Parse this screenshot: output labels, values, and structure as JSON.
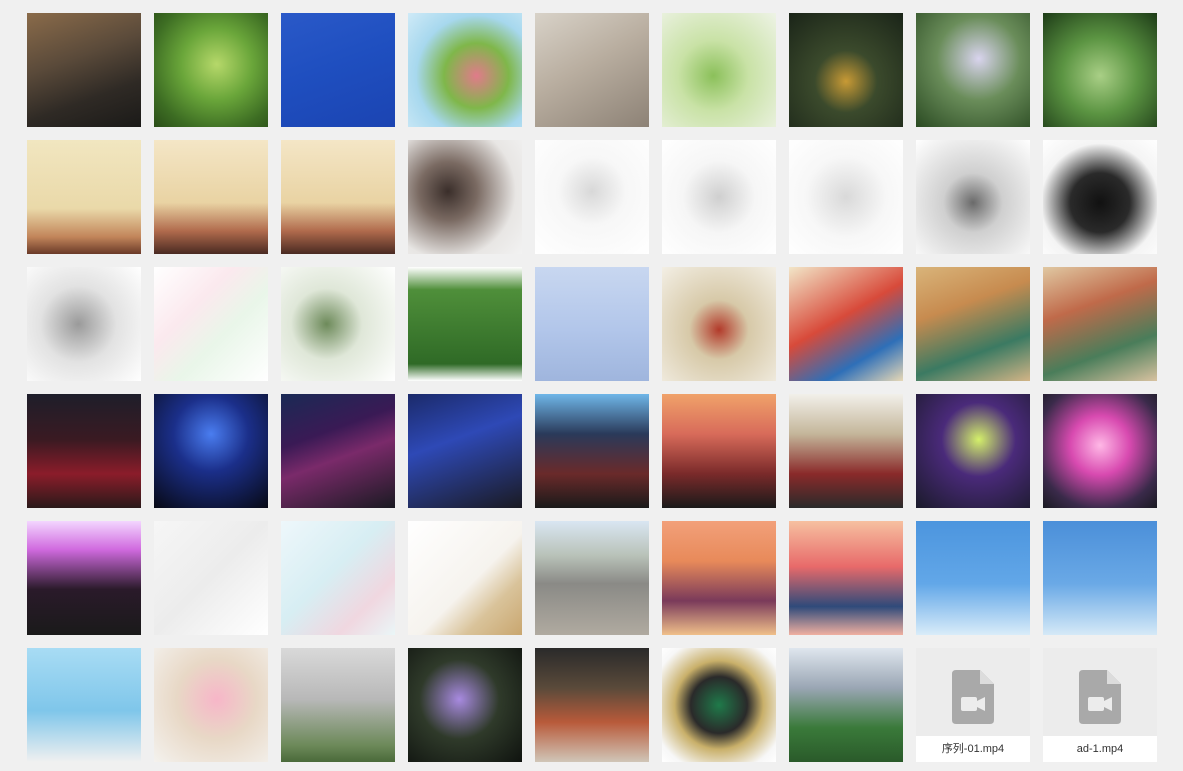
{
  "gallery": {
    "tiles": [
      {
        "kind": "image",
        "icon": "boardwalk-photo-icon",
        "bg": "linear-gradient(160deg,#8a6b4a 0%,#5a4a3a 40%,#2f2a25 70%,#1b1a18 100%)"
      },
      {
        "kind": "image",
        "icon": "green-plant-photo-icon",
        "bg": "radial-gradient(circle at 55% 45%,#b6d86a 0%,#6aa63a 40%,#3d6d23 75%,#2a4d18 100%)"
      },
      {
        "kind": "image",
        "icon": "blue-sky-contrail-photo-icon",
        "bg": "linear-gradient(160deg,#2a59c8 0%,#1f4fc0 45%,#1b44b2 100%)"
      },
      {
        "kind": "image",
        "icon": "peach-blossom-photo-icon",
        "bg": "radial-gradient(circle at 60% 55%,#e07b8a 0%,#7fb74a 35%,#a7d8ee 65%,#cfeaf7 100%)"
      },
      {
        "kind": "image",
        "icon": "cat-photo-icon",
        "bg": "linear-gradient(150deg,#d8d2c8 0%,#b9aea0 45%,#8d8276 100%)"
      },
      {
        "kind": "image",
        "icon": "green-bud-photo-icon",
        "bg": "radial-gradient(circle at 45% 55%,#8bc05a 0%,#c9e2a6 40%,#eef3e6 100%)"
      },
      {
        "kind": "image",
        "icon": "bird-photo-icon",
        "bg": "radial-gradient(circle at 50% 60%,#c89a35 0%,#3b4a2c 35%,#1a2418 100%)"
      },
      {
        "kind": "image",
        "icon": "lilac-flower-photo-icon",
        "bg": "radial-gradient(circle at 55% 40%,#d9d4ee 0%,#6a8d5a 45%,#2a4a22 100%)"
      },
      {
        "kind": "image",
        "icon": "lotus-leaf-photo-icon",
        "bg": "radial-gradient(circle at 50% 55%,#a9cf86 0%,#5b9442 45%,#1d3b17 100%)"
      },
      {
        "kind": "image",
        "icon": "poster-warrior-photo-icon",
        "bg": "linear-gradient(180deg,#f1e6c0 0%,#ead9a9 60%,#c2855a 85%,#6a3a28 100%)"
      },
      {
        "kind": "image",
        "icon": "poster-woman-photo-icon",
        "bg": "linear-gradient(180deg,#f4e6c6 0%,#e9d3a3 55%,#b06a4c 80%,#4a2a22 100%)"
      },
      {
        "kind": "image",
        "icon": "poster-woman-photo-icon",
        "bg": "linear-gradient(180deg,#f4e6c6 0%,#e9d3a3 55%,#b06a4c 80%,#4a2a22 100%)"
      },
      {
        "kind": "image",
        "icon": "portrait-photo-icon",
        "bg": "radial-gradient(circle at 35% 45%,#3a2e2a 0%,#7a6a62 30%,#e8e6e4 70%,#f2f2f2 100%)"
      },
      {
        "kind": "image",
        "icon": "illustration-girl-photo-icon",
        "bg": "radial-gradient(circle at 50% 45%,#d8d8d8 0%,#f7f7f7 40%,#ffffff 100%)"
      },
      {
        "kind": "image",
        "icon": "illustration-figures-photo-icon",
        "bg": "radial-gradient(circle at 50% 50%,#cfcfcf 0%,#f6f6f6 45%,#ffffff 100%)"
      },
      {
        "kind": "image",
        "icon": "sketch-figures-photo-icon",
        "bg": "radial-gradient(circle at 50% 50%,#d9d9d9 0%,#f7f7f7 50%,#ffffff 100%)"
      },
      {
        "kind": "image",
        "icon": "sketch-character-photo-icon",
        "bg": "radial-gradient(circle at 50% 55%,#6a6a6a 0%,#cfcfcf 35%,#ffffff 100%)"
      },
      {
        "kind": "image",
        "icon": "umbrella-figure-photo-icon",
        "bg": "radial-gradient(circle at 50% 55%,#111111 0%,#2a2a2a 35%,#f4f4f4 70%,#ffffff 100%)"
      },
      {
        "kind": "image",
        "icon": "sketch-scene-photo-icon",
        "bg": "radial-gradient(circle at 45% 50%,#9a9a9a 0%,#e2e2e2 45%,#ffffff 100%)"
      },
      {
        "kind": "image",
        "icon": "collage-portraits-photo-icon",
        "bg": "linear-gradient(135deg,#ffffff 0%,#fbe9ee 35%,#e9f6e9 60%,#ffffff 100%)"
      },
      {
        "kind": "image",
        "icon": "circle-collage-photo-icon",
        "bg": "radial-gradient(circle at 40% 50%,#6d8a5a 0%,#dfe7d8 40%,#ffffff 100%)"
      },
      {
        "kind": "image",
        "icon": "lawn-couple-photo-icon",
        "bg": "linear-gradient(180deg,#ffffff 0%,#4f8f3a 20%,#2f6a26 85%,#ffffff 100%)"
      },
      {
        "kind": "image",
        "icon": "studio-group-photo-icon",
        "bg": "linear-gradient(180deg,#c8d7f0 0%,#b2c6ea 55%,#9fb5dd 100%)"
      },
      {
        "kind": "image",
        "icon": "ink-painting-photo-icon",
        "bg": "radial-gradient(circle at 50% 55%,#b23a2a 0%,#d7c9a8 35%,#f3efe5 100%)"
      },
      {
        "kind": "image",
        "icon": "traditional-figures-photo-icon",
        "bg": "linear-gradient(150deg,#f2e6c8 0%,#d84a3a 45%,#2e6fb8 75%,#e7d8b6 100%)"
      },
      {
        "kind": "image",
        "icon": "palace-scene-photo-icon",
        "bg": "linear-gradient(160deg,#d9b47a 0%,#c78b4f 35%,#3b7a62 70%,#d2b486 100%)"
      },
      {
        "kind": "image",
        "icon": "courtyard-scene-photo-icon",
        "bg": "linear-gradient(160deg,#e0c8a2 0%,#c06a4a 35%,#4a7d5a 70%,#d8c2a0 100%)"
      },
      {
        "kind": "image",
        "icon": "choir-stage-photo-icon",
        "bg": "linear-gradient(180deg,#1e1e2a 0%,#3a1a22 40%,#8b1c2a 70%,#2a1a1a 100%)"
      },
      {
        "kind": "image",
        "icon": "moon-stage-photo-icon",
        "bg": "radial-gradient(circle at 50% 35%,#4a7df0 0%,#1b2f8a 40%,#070914 100%)"
      },
      {
        "kind": "image",
        "icon": "singer-stage-photo-icon",
        "bg": "linear-gradient(160deg,#1a2a55 0%,#3a1a55 35%,#7a2a6a 55%,#1a1a22 100%)"
      },
      {
        "kind": "image",
        "icon": "banner-stage-photo-icon",
        "bg": "linear-gradient(160deg,#1b2a6a 0%,#2e49b6 40%,#1a1a22 100%)"
      },
      {
        "kind": "image",
        "icon": "screen-stage-photo-icon",
        "bg": "linear-gradient(180deg,#6fb6e8 0%,#2a3a5a 35%,#6a2a2a 70%,#1a1a1a 100%)"
      },
      {
        "kind": "image",
        "icon": "dancer-stage-photo-icon",
        "bg": "linear-gradient(180deg,#f0a26a 0%,#d86b5a 35%,#7a2a2a 70%,#1a1a1a 100%)"
      },
      {
        "kind": "image",
        "icon": "performance-stage-photo-icon",
        "bg": "linear-gradient(180deg,#f2f0ea 0%,#c4b69a 35%,#8a2a2a 70%,#2a2a2a 100%)"
      },
      {
        "kind": "image",
        "icon": "spotlight-speaker-photo-icon",
        "bg": "radial-gradient(circle at 55% 40%,#d4f06a 0%,#4a2a7a 40%,#1a1a2a 100%)"
      },
      {
        "kind": "image",
        "icon": "fan-dance-photo-icon",
        "bg": "radial-gradient(circle at 50% 45%,#ffb8e6 0%,#d84ab0 35%,#3a2a4a 75%,#1a1a22 100%)"
      },
      {
        "kind": "image",
        "icon": "group-photo-icon",
        "bg": "linear-gradient(180deg,#f3d6ff 0%,#d06adf 25%,#2a1a2a 60%,#1a1a1a 100%)"
      },
      {
        "kind": "image",
        "icon": "handrail-photo-icon",
        "bg": "linear-gradient(135deg,#f6f6f6 0%,#ececec 50%,#ffffff 100%)"
      },
      {
        "kind": "image",
        "icon": "floral-fabric-photo-icon",
        "bg": "linear-gradient(135deg,#eef7fb 0%,#d7eef3 45%,#f0d7e0 75%,#eaf6f7 100%)"
      },
      {
        "kind": "image",
        "icon": "wall-shadow-photo-icon",
        "bg": "linear-gradient(135deg,#ffffff 0%,#f6f3ee 55%,#d9c39a 75%,#c9a66f 100%)"
      },
      {
        "kind": "image",
        "icon": "street-portrait-photo-icon",
        "bg": "linear-gradient(180deg,#d9e6f2 0%,#b9c2b9 30%,#8a8a86 55%,#b0aaa0 100%)"
      },
      {
        "kind": "image",
        "icon": "family-illustration-photo-icon",
        "bg": "linear-gradient(180deg,#f2a07a 0%,#e88a5a 35%,#7a3a5a 70%,#f0c08a 100%)"
      },
      {
        "kind": "image",
        "icon": "couple-illustration-photo-icon",
        "bg": "linear-gradient(180deg,#f6c0a0 0%,#e86a6a 40%,#2f4a7a 75%,#f0b0a0 100%)"
      },
      {
        "kind": "image",
        "icon": "kiwi-sky-photo-icon",
        "bg": "linear-gradient(180deg,#4c95de 0%,#62a7e8 55%,#d9ecf9 100%)"
      },
      {
        "kind": "image",
        "icon": "strawberry-sky-photo-icon",
        "bg": "linear-gradient(180deg,#4b8fd9 0%,#6aa9e6 55%,#d5e9f7 100%)"
      },
      {
        "kind": "image",
        "icon": "parachute-illustration-photo-icon",
        "bg": "linear-gradient(180deg,#a8dcf4 0%,#7fc6ea 55%,#f0f0f0 100%)"
      },
      {
        "kind": "image",
        "icon": "pink-blossom-photo-icon",
        "bg": "radial-gradient(circle at 55% 45%,#f7b6c8 0%,#e8d8c6 45%,#f4f2ee 100%)"
      },
      {
        "kind": "image",
        "icon": "sprout-wall-photo-icon",
        "bg": "linear-gradient(180deg,#d9d9d9 0%,#b8b8b8 45%,#6d8a5a 85%,#4a6a3a 100%)"
      },
      {
        "kind": "image",
        "icon": "purple-flower-photo-icon",
        "bg": "radial-gradient(circle at 45% 45%,#a88ae0 0%,#2f3a2a 45%,#0f130f 100%)"
      },
      {
        "kind": "image",
        "icon": "bookshop-storefront-photo-icon",
        "bg": "linear-gradient(180deg,#2a2a2a 0%,#5a4a3a 35%,#b85a3a 65%,#d0c6b8 100%)"
      },
      {
        "kind": "image",
        "icon": "slytherin-crest-photo-icon",
        "bg": "radial-gradient(circle at 50% 50%,#1f7a4a 0%,#2a2a2a 35%,#c9b06a 55%,#f7f7f7 85%,#ffffff 100%)"
      },
      {
        "kind": "image",
        "icon": "world-cup-trophy-photo-icon",
        "bg": "linear-gradient(180deg,#dfe6ee 0%,#9aa6b4 35%,#3a7a3a 70%,#2a5a2a 100%)"
      },
      {
        "kind": "video",
        "icon": "video-file-icon",
        "name": "序列-01.mp4"
      },
      {
        "kind": "video",
        "icon": "video-file-icon",
        "name": "ad-1.mp4"
      }
    ]
  }
}
